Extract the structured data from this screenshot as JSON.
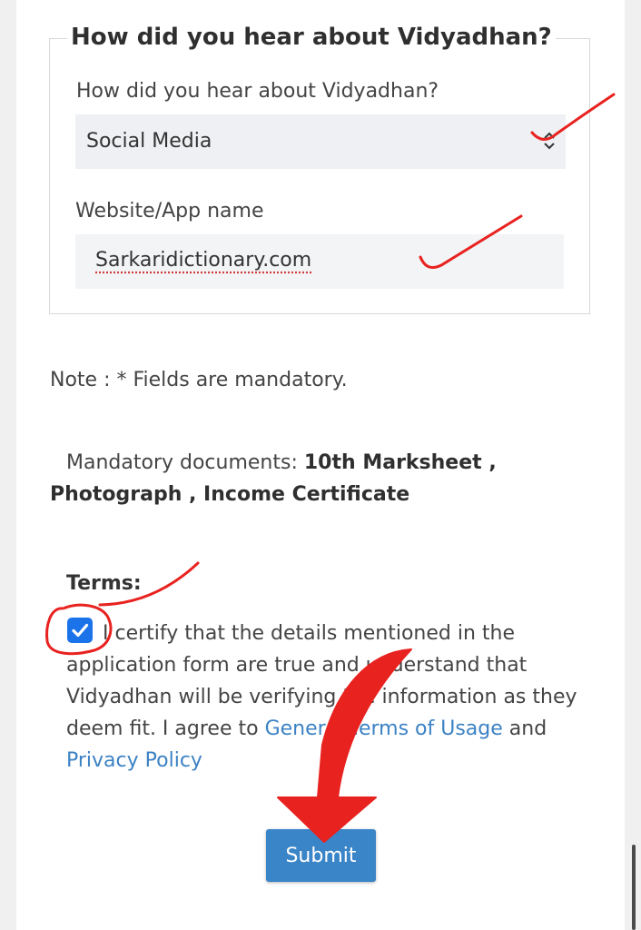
{
  "section": {
    "legend": "How did you hear about Vidyadhan?",
    "source_label": "How did you hear about Vidyadhan?",
    "source_value": "Social Media",
    "website_label": "Website/App name",
    "website_value": "Sarkaridictionary.com"
  },
  "note": "Note : * Fields are mandatory.",
  "docs": {
    "prefix": "Mandatory documents: ",
    "list": "10th Marksheet , Photograph , Income Certificate"
  },
  "terms": {
    "title": "Terms:",
    "checked": true,
    "text_before": "I certify that the details mentioned in the application form are true and understand that Vidyadhan will be verifying the information as they deem fit. I agree to ",
    "link1": "General Terms of Usage",
    "text_mid": " and ",
    "link2": "Privacy Policy"
  },
  "submit_label": "Submit",
  "colors": {
    "annotation": "#e8221f",
    "accent": "#3a84c8",
    "link": "#3c82c4"
  }
}
